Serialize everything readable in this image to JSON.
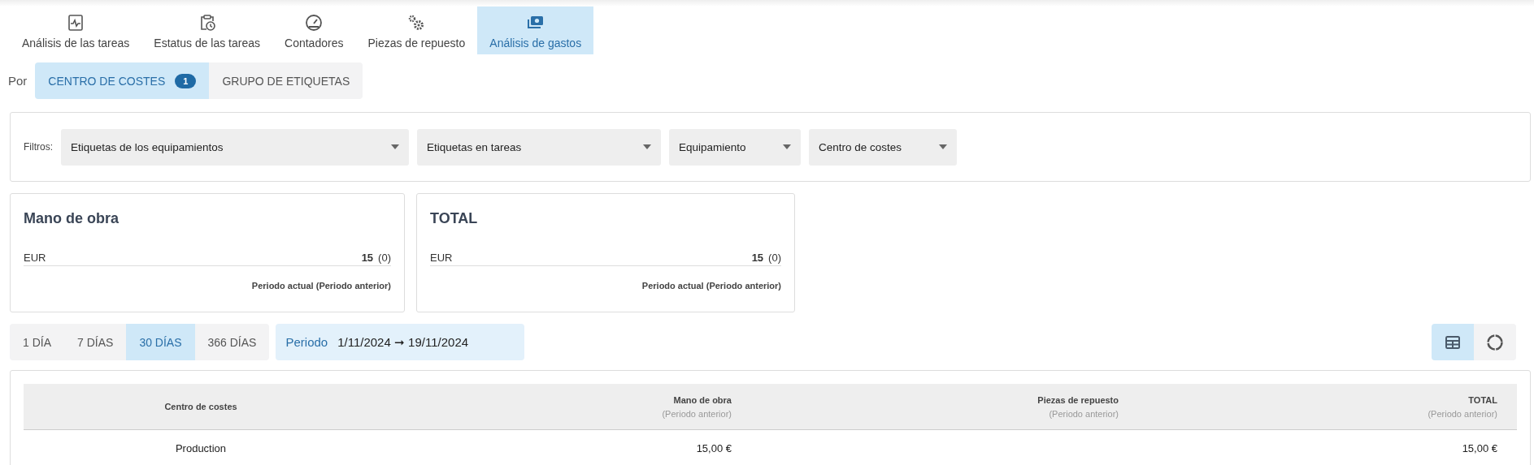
{
  "tabs": [
    {
      "label": "Análisis de las tareas",
      "kind": "chart",
      "selected": false
    },
    {
      "label": "Estatus de las tareas",
      "kind": "clipboard",
      "selected": false
    },
    {
      "label": "Contadores",
      "kind": "gauge",
      "selected": false
    },
    {
      "label": "Piezas de repuesto",
      "kind": "gears",
      "selected": false
    },
    {
      "label": "Análisis de gastos",
      "kind": "money",
      "selected": true
    }
  ],
  "group_by": {
    "label": "Por",
    "options": [
      {
        "label": "CENTRO DE COSTES",
        "badge": "1",
        "selected": true
      },
      {
        "label": "GRUPO DE ETIQUETAS",
        "selected": false
      }
    ]
  },
  "filters": {
    "label": "Filtros:",
    "dropdowns": [
      {
        "label": "Etiquetas de los equipamientos"
      },
      {
        "label": "Etiquetas en tareas"
      },
      {
        "label": "Equipamiento"
      },
      {
        "label": "Centro de costes"
      }
    ]
  },
  "cards": [
    {
      "title": "Mano de obra",
      "currency": "EUR",
      "value": "15",
      "previous": "(0)",
      "footnote": "Periodo actual (Periodo anterior)"
    },
    {
      "title": "TOTAL",
      "currency": "EUR",
      "value": "15",
      "previous": "(0)",
      "footnote": "Periodo actual (Periodo anterior)"
    }
  ],
  "ranges": [
    {
      "label": "1 DÍA",
      "selected": false
    },
    {
      "label": "7 DÍAS",
      "selected": false
    },
    {
      "label": "30 DÍAS",
      "selected": true
    },
    {
      "label": "366 DÍAS",
      "selected": false
    }
  ],
  "period": {
    "label": "Periodo",
    "value": "1/11/2024 ➞ 19/11/2024"
  },
  "views": [
    {
      "kind": "table",
      "selected": true
    },
    {
      "kind": "donut",
      "selected": false
    }
  ],
  "table": {
    "columns": [
      {
        "label": "Centro de costes"
      },
      {
        "label": "Mano de obra",
        "sublabel": "(Periodo anterior)"
      },
      {
        "label": "Piezas de repuesto",
        "sublabel": "(Periodo anterior)"
      },
      {
        "label": "TOTAL",
        "sublabel": "(Periodo anterior)"
      }
    ],
    "rows": [
      [
        "Production",
        "15,00 €",
        "",
        "15,00 €"
      ]
    ]
  }
}
